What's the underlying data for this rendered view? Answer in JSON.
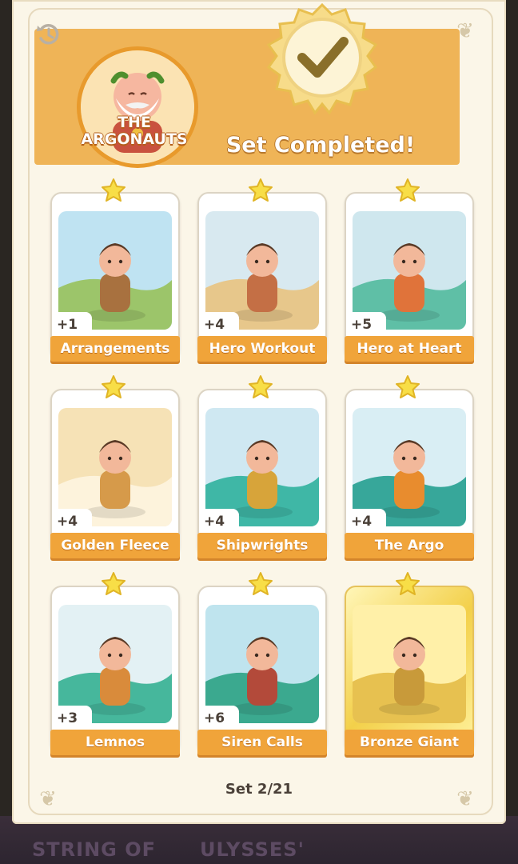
{
  "header": {
    "set_name_line1": "THE",
    "set_name_line2": "ARGONAUTS",
    "status": "Set Completed!"
  },
  "cards": [
    {
      "title": "Arrangements",
      "count": "+1",
      "stars": 1,
      "gold": false
    },
    {
      "title": "Hero Workout",
      "count": "+4",
      "stars": 1,
      "gold": false
    },
    {
      "title": "Hero at Heart",
      "count": "+5",
      "stars": 1,
      "gold": false
    },
    {
      "title": "Golden Fleece",
      "count": "+4",
      "stars": 1,
      "gold": false
    },
    {
      "title": "Shipwrights",
      "count": "+4",
      "stars": 1,
      "gold": false
    },
    {
      "title": "The Argo",
      "count": "+4",
      "stars": 1,
      "gold": false
    },
    {
      "title": "Lemnos",
      "count": "+3",
      "stars": 1,
      "gold": false
    },
    {
      "title": "Siren Calls",
      "count": "+6",
      "stars": 1,
      "gold": false
    },
    {
      "title": "Bronze Giant",
      "count": "",
      "stars": 1,
      "gold": true
    }
  ],
  "footer": {
    "set_progress": "Set 2/21"
  },
  "background_peek": {
    "left": "STRING OF",
    "right": "ULYSSES'"
  },
  "colors": {
    "accent": "#f0a43a",
    "header": "#efb457",
    "panel": "#fbf6e8",
    "text": "#4a4038"
  }
}
